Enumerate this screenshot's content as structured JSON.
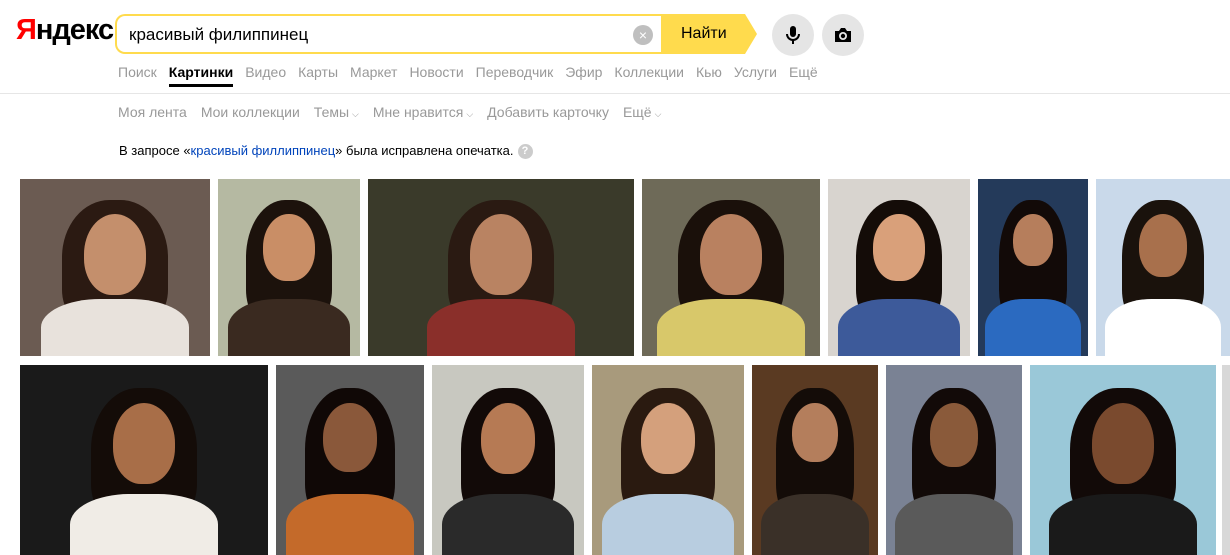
{
  "logo": {
    "first": "Я",
    "rest": "ндекс"
  },
  "search": {
    "value": "красивый филиппинец",
    "placeholder": "",
    "button": "Найти",
    "clear_icon": "×"
  },
  "services": [
    "Поиск",
    "Картинки",
    "Видео",
    "Карты",
    "Маркет",
    "Новости",
    "Переводчик",
    "Эфир",
    "Коллекции",
    "Кью",
    "Услуги",
    "Ещё"
  ],
  "active_service": "Картинки",
  "subnav": [
    {
      "label": "Моя лента",
      "caret": false
    },
    {
      "label": "Мои коллекции",
      "caret": false
    },
    {
      "label": "Темы",
      "caret": true
    },
    {
      "label": "Мне нравится",
      "caret": true
    },
    {
      "label": "Добавить карточку",
      "caret": false
    },
    {
      "label": "Ещё",
      "caret": true
    }
  ],
  "notice": {
    "before": "В запросе «",
    "query": "красивый филлиппинец",
    "after": "» была исправлена опечатка.",
    "help": "?"
  },
  "colors": {
    "accent": "#ffdb4d",
    "link": "#0044bb",
    "logo_red": "#ff0000"
  },
  "icons": {
    "mic": "microphone-icon",
    "camera": "camera-icon",
    "clear": "clear-icon",
    "help": "help-icon"
  }
}
